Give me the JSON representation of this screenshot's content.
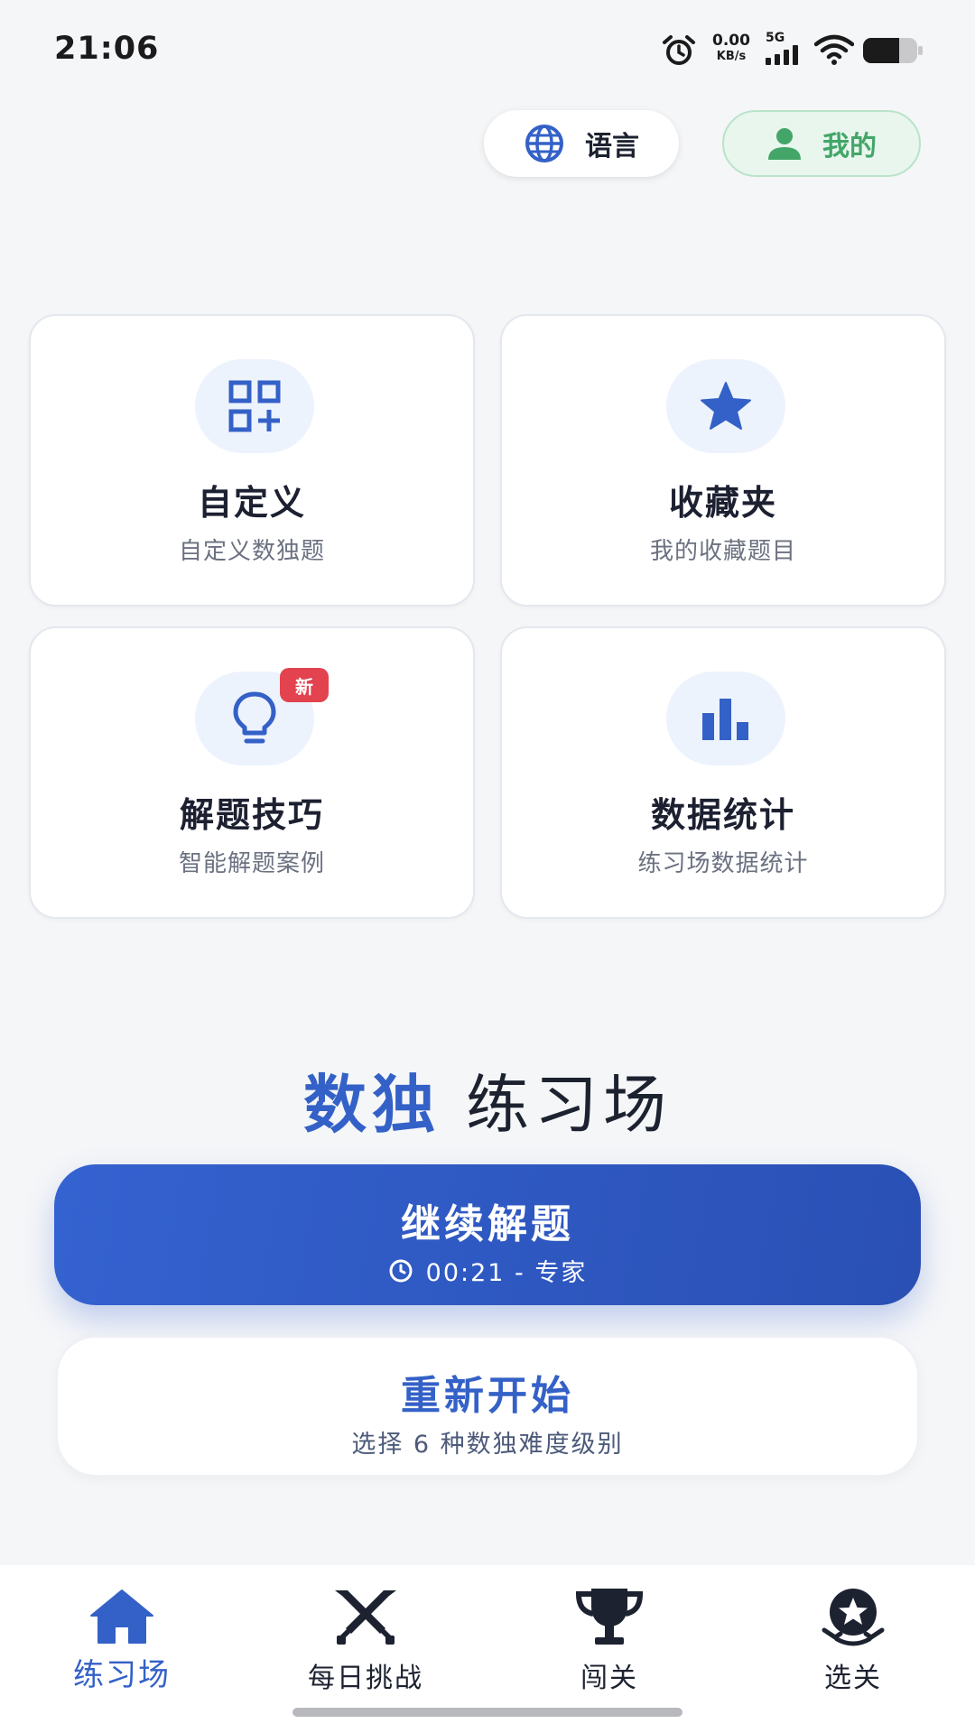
{
  "status_bar": {
    "time": "21:06",
    "net_speed_value": "0.00",
    "net_speed_unit": "KB/s",
    "network_type": "5G",
    "icons": [
      "alarm-icon",
      "signal-icon",
      "wifi-icon",
      "battery-icon"
    ]
  },
  "header": {
    "language_label": "语言",
    "me_label": "我的"
  },
  "cards": [
    {
      "title": "自定义",
      "subtitle": "自定义数独题",
      "icon": "grid-add-icon"
    },
    {
      "title": "收藏夹",
      "subtitle": "我的收藏题目",
      "icon": "star-icon"
    },
    {
      "title": "解题技巧",
      "subtitle": "智能解题案例",
      "icon": "lightbulb-icon",
      "badge": "新"
    },
    {
      "title": "数据统计",
      "subtitle": "练习场数据统计",
      "icon": "bar-chart-icon"
    }
  ],
  "headline": {
    "brand": "数独",
    "rest": "练习场"
  },
  "continue_button": {
    "label": "继续解题",
    "detail": "00:21 - 专家"
  },
  "restart_button": {
    "label": "重新开始",
    "detail": "选择 6 种数独难度级别"
  },
  "bottom_nav": [
    {
      "label": "练习场",
      "icon": "home-icon",
      "active": true
    },
    {
      "label": "每日挑战",
      "icon": "crossed-swords-icon",
      "active": false
    },
    {
      "label": "闯关",
      "icon": "trophy-icon",
      "active": false
    },
    {
      "label": "选关",
      "icon": "star-medal-icon",
      "active": false
    }
  ],
  "colors": {
    "accent": "#3461c7",
    "green": "#43a668",
    "badge_red": "#e2434f",
    "background": "#f5f6f8"
  }
}
